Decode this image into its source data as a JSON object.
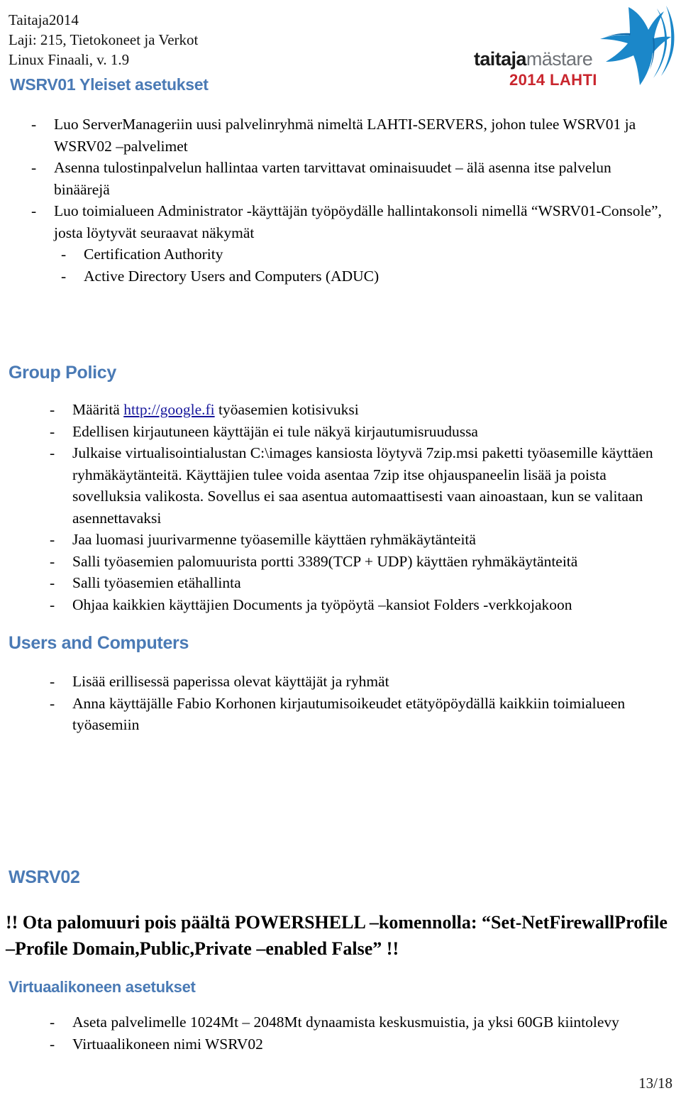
{
  "header": {
    "line1": "Taitaja2014",
    "line2": "Laji: 215, Tietokoneet ja Verkot",
    "line3": "Linux Finaali, v. 1.9"
  },
  "logo": {
    "word_dark": "taitaja",
    "word_light": "mästare",
    "sub": "2014 LAHTI",
    "mark_name": "taitaja-bird-mark",
    "colors": {
      "mark_blue": "#1b87c9",
      "mark_blue_dark": "#1169a8",
      "sub_red": "#c9252d",
      "word_dark": "#1a1a1a",
      "word_light": "#6f7277"
    }
  },
  "theme": {
    "heading_blue": "#4a7ab5",
    "link_blue": "#17179c",
    "body_black": "#000000"
  },
  "sections": {
    "wsrv01": {
      "heading": "WSRV01 Yleiset asetukset",
      "items": [
        {
          "level": 1,
          "text": "Luo ServerManageriin uusi palvelinryhmä nimeltä LAHTI-SERVERS, johon tulee WSRV01 ja WSRV02 –palvelimet"
        },
        {
          "level": 1,
          "text": "Asenna tulostinpalvelun hallintaa varten tarvittavat ominaisuudet – älä asenna itse palvelun binäärejä"
        },
        {
          "level": 1,
          "text": "Luo toimialueen Administrator -käyttäjän työpöydälle hallintakonsoli nimellä “WSRV01-Console”, josta löytyvät seuraavat näkymät"
        },
        {
          "level": 2,
          "text": "Certification Authority"
        },
        {
          "level": 2,
          "text": "Active Directory Users and Computers (ADUC)"
        }
      ]
    },
    "group_policy": {
      "heading": "Group Policy",
      "items": [
        {
          "level": 1,
          "pre": "Määritä ",
          "link": "http://google.fi",
          "post": " työasemien kotisivuksi"
        },
        {
          "level": 1,
          "text": "Edellisen kirjautuneen käyttäjän ei tule näkyä kirjautumisruudussa"
        },
        {
          "level": 1,
          "text": "Julkaise virtualisointialustan C:\\images kansiosta löytyvä 7zip.msi paketti työasemille käyttäen ryhmäkäytänteitä. Käyttäjien tulee voida asentaa 7zip itse ohjauspaneelin lisää ja poista sovelluksia valikosta. Sovellus ei saa asentua automaattisesti vaan ainoastaan, kun se valitaan asennettavaksi"
        },
        {
          "level": 1,
          "text": "Jaa luomasi  juurivarmenne työasemille käyttäen ryhmäkäytänteitä"
        },
        {
          "level": 1,
          "text": "Salli työasemien palomuurista portti 3389(TCP + UDP) käyttäen ryhmäkäytänteitä"
        },
        {
          "level": 1,
          "text": "Salli työasemien etähallinta"
        },
        {
          "level": 1,
          "text": "Ohjaa kaikkien käyttäjien Documents ja työpöytä –kansiot Folders -verkkojakoon"
        }
      ]
    },
    "users_and_computers": {
      "heading": "Users and Computers",
      "items": [
        {
          "level": 1,
          "text": "Lisää erillisessä paperissa olevat käyttäjät ja ryhmät"
        },
        {
          "level": 1,
          "text": "Anna käyttäjälle Fabio Korhonen kirjautumisoikeudet etätyöpöydällä kaikkiin toimialueen työasemiin"
        }
      ]
    },
    "wsrv02": {
      "heading": "WSRV02",
      "callout": "!! Ota palomuuri pois päältä POWERSHELL –komennolla: “Set-NetFirewallProfile –Profile Domain,Public,Private –enabled False” !!"
    },
    "virtual_machine": {
      "heading": "Virtuaalikoneen asetukset",
      "items": [
        {
          "level": 1,
          "text": "Aseta palvelimelle 1024Mt – 2048Mt dynaamista keskusmuistia, ja yksi 60GB kiintolevy"
        },
        {
          "level": 1,
          "text": "Virtuaalikoneen nimi WSRV02"
        }
      ]
    }
  },
  "footer": {
    "page_number": "13/18"
  },
  "bullet_char": "-"
}
